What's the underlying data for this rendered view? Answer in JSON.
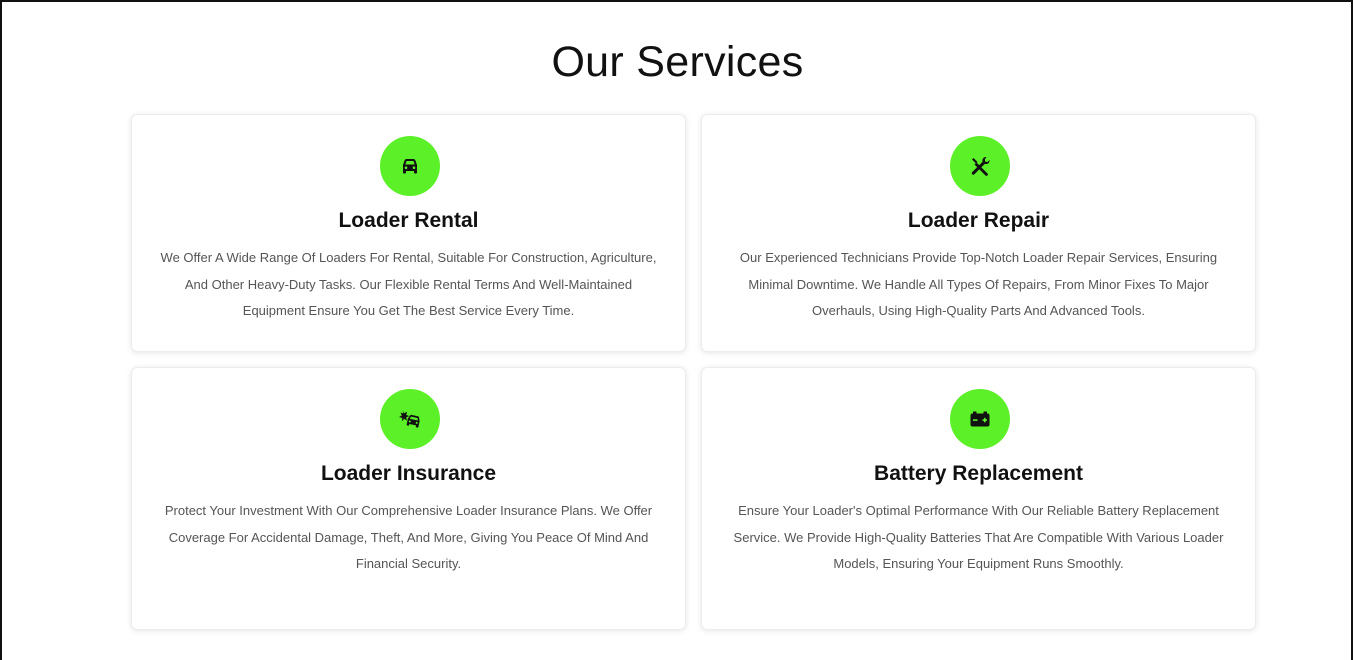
{
  "section": {
    "title_part1": "Our ",
    "title_part2": "Services",
    "accent_color": "#5cf028"
  },
  "services": [
    {
      "icon": "car-icon",
      "title": "Loader Rental",
      "text": "We Offer A Wide Range Of Loaders For Rental, Suitable For Construction, Agriculture, And Other Heavy-Duty Tasks. Our Flexible Rental Terms And Well-Maintained Equipment Ensure You Get The Best Service Every Time."
    },
    {
      "icon": "tools-icon",
      "title": "Loader Repair",
      "text": "Our Experienced Technicians Provide Top-Notch Loader Repair Services, Ensuring Minimal Downtime. We Handle All Types Of Repairs, From Minor Fixes To Major Overhauls, Using High-Quality Parts And Advanced Tools."
    },
    {
      "icon": "car-crash-icon",
      "title": "Loader Insurance",
      "text": "Protect Your Investment With Our Comprehensive Loader Insurance Plans. We Offer Coverage For Accidental Damage, Theft, And More, Giving You Peace Of Mind And Financial Security."
    },
    {
      "icon": "battery-icon",
      "title": "Battery Replacement",
      "text": "Ensure Your Loader's Optimal Performance With Our Reliable Battery Replacement Service. We Provide High-Quality Batteries That Are Compatible With Various Loader Models, Ensuring Your Equipment Runs Smoothly."
    }
  ]
}
